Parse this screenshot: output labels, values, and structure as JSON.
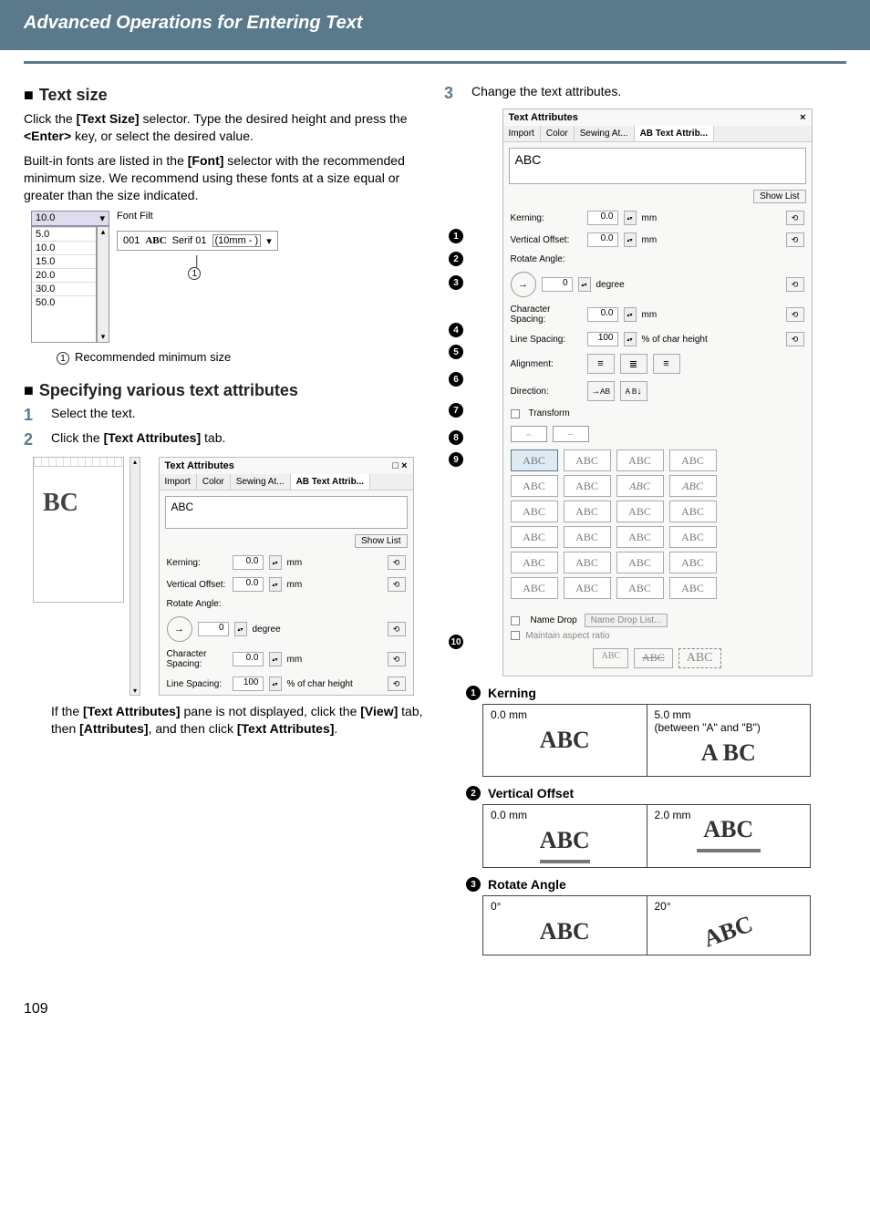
{
  "header_title": "Advanced Operations for Entering Text",
  "page_number": "109",
  "left": {
    "section1_title": "Text size",
    "p1a": "Click the ",
    "p1b": "[Text Size]",
    "p1c": " selector. Type the desired height and press the ",
    "p1d": "<Enter>",
    "p1e": " key, or select the desired value.",
    "p2a": "Built-in fonts are listed in the ",
    "p2b": "[Font]",
    "p2c": " selector with the recommended minimum size. We recommend using these fonts at a size equal or greater than the size indicated.",
    "dropdown": {
      "current": "10.0",
      "label": "Font Filt",
      "options": [
        "5.0",
        "10.0",
        "15.0",
        "20.0",
        "30.0",
        "50.0"
      ],
      "font_chip": {
        "num": "001",
        "name": "ABC",
        "style": "Serif 01",
        "min": "(10mm - )"
      }
    },
    "note1": "Recommended minimum size",
    "section2_title": "Specifying various text attributes",
    "step1": "Select the text.",
    "step2a": "Click the ",
    "step2b": "[Text Attributes]",
    "step2c": " tab.",
    "help_a": "If the ",
    "help_b": "[Text Attributes]",
    "help_c": " pane is not displayed, click the ",
    "help_d": "[View]",
    "help_e": " tab, then ",
    "help_f": "[Attributes]",
    "help_g": ", and then click ",
    "help_h": "[Text Attributes]",
    "help_i": "."
  },
  "right": {
    "step3": "Change the text attributes."
  },
  "panel": {
    "title": "Text Attributes",
    "tabs": {
      "import": "Import",
      "color": "Color",
      "sewing": "Sewing At...",
      "textattr": "AB Text Attrib..."
    },
    "preview_text": "ABC",
    "show_list": "Show List",
    "kerning": {
      "label": "Kerning:",
      "value": "0.0",
      "unit": "mm"
    },
    "voffset": {
      "label": "Vertical Offset:",
      "value": "0.0",
      "unit": "mm"
    },
    "rotate": {
      "label": "Rotate Angle:",
      "value": "0",
      "unit": "degree"
    },
    "charspacing": {
      "label": "Character Spacing:",
      "value": "0.0",
      "unit": "mm"
    },
    "linespacing": {
      "label": "Line Spacing:",
      "value": "100",
      "unit": "% of char height"
    },
    "alignment": {
      "label": "Alignment:"
    },
    "direction": {
      "label": "Direction:",
      "h": "→\nAB",
      "v": "A\nB↓"
    },
    "transform": "Transform",
    "name_drop": "Name Drop",
    "name_drop_list": "Name Drop List...",
    "maintain_aspect": "Maintain aspect ratio",
    "close_x": "×",
    "arrow": "→",
    "align_icons": {
      "left": "≡",
      "center": "≣",
      "right": "≡"
    },
    "dir_h": "AB",
    "dir_v": "A B",
    "size_chips": [
      "ABC",
      "ABC",
      "ABC"
    ]
  },
  "callouts": [
    "1",
    "2",
    "3",
    "4",
    "5",
    "6",
    "7",
    "8",
    "9",
    "10"
  ],
  "cmp": {
    "kerning": {
      "title": "Kerning",
      "c1": "0.0 mm",
      "c2": "5.0 mm",
      "c2b": "(between \"A\" and \"B\")",
      "s1": "ABC",
      "s2": "A BC"
    },
    "voffset": {
      "title": "Vertical Offset",
      "c1": "0.0 mm",
      "c2": "2.0 mm",
      "s": "ABC"
    },
    "rotate": {
      "title": "Rotate Angle",
      "c1": "0°",
      "c2": "20°",
      "s": "ABC"
    }
  },
  "transform_grid": [
    [
      "ABC",
      "ABC",
      "ABC",
      "ABC"
    ],
    [
      "ABC",
      "ABC",
      "ABC",
      "ABC"
    ],
    [
      "ABC",
      "ABC",
      "ABC",
      "ABC"
    ],
    [
      "ABC",
      "ABC",
      "ABC",
      "ABC"
    ],
    [
      "ABC",
      "ABC",
      "ABC",
      "ABC"
    ],
    [
      "ABC",
      "ABC",
      "ABC",
      "ABC"
    ]
  ]
}
